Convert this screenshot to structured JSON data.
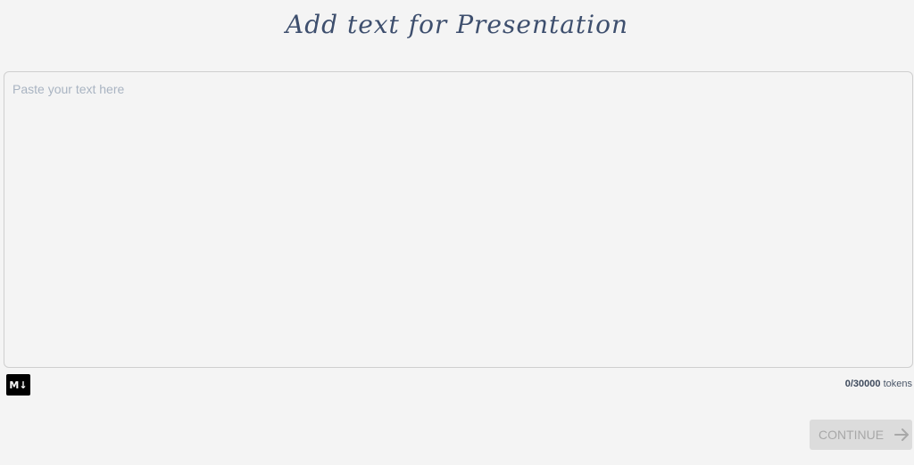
{
  "header": {
    "title": "Add text for Presentation"
  },
  "editor": {
    "value": "",
    "placeholder": "Paste your text here"
  },
  "footer": {
    "markdown_badge": "M↓",
    "token_count": "0/30000",
    "token_unit": "tokens"
  },
  "actions": {
    "continue_label": "CONTINUE"
  },
  "colors": {
    "title": "#3e4f6e",
    "placeholder": "#a9b4c2",
    "button_bg": "#dcdcdc",
    "button_text": "#a8a8a8",
    "background": "#f4f4f4"
  },
  "icons": {
    "markdown": "markdown-icon",
    "continue_arrow": "arrow-right-icon"
  }
}
